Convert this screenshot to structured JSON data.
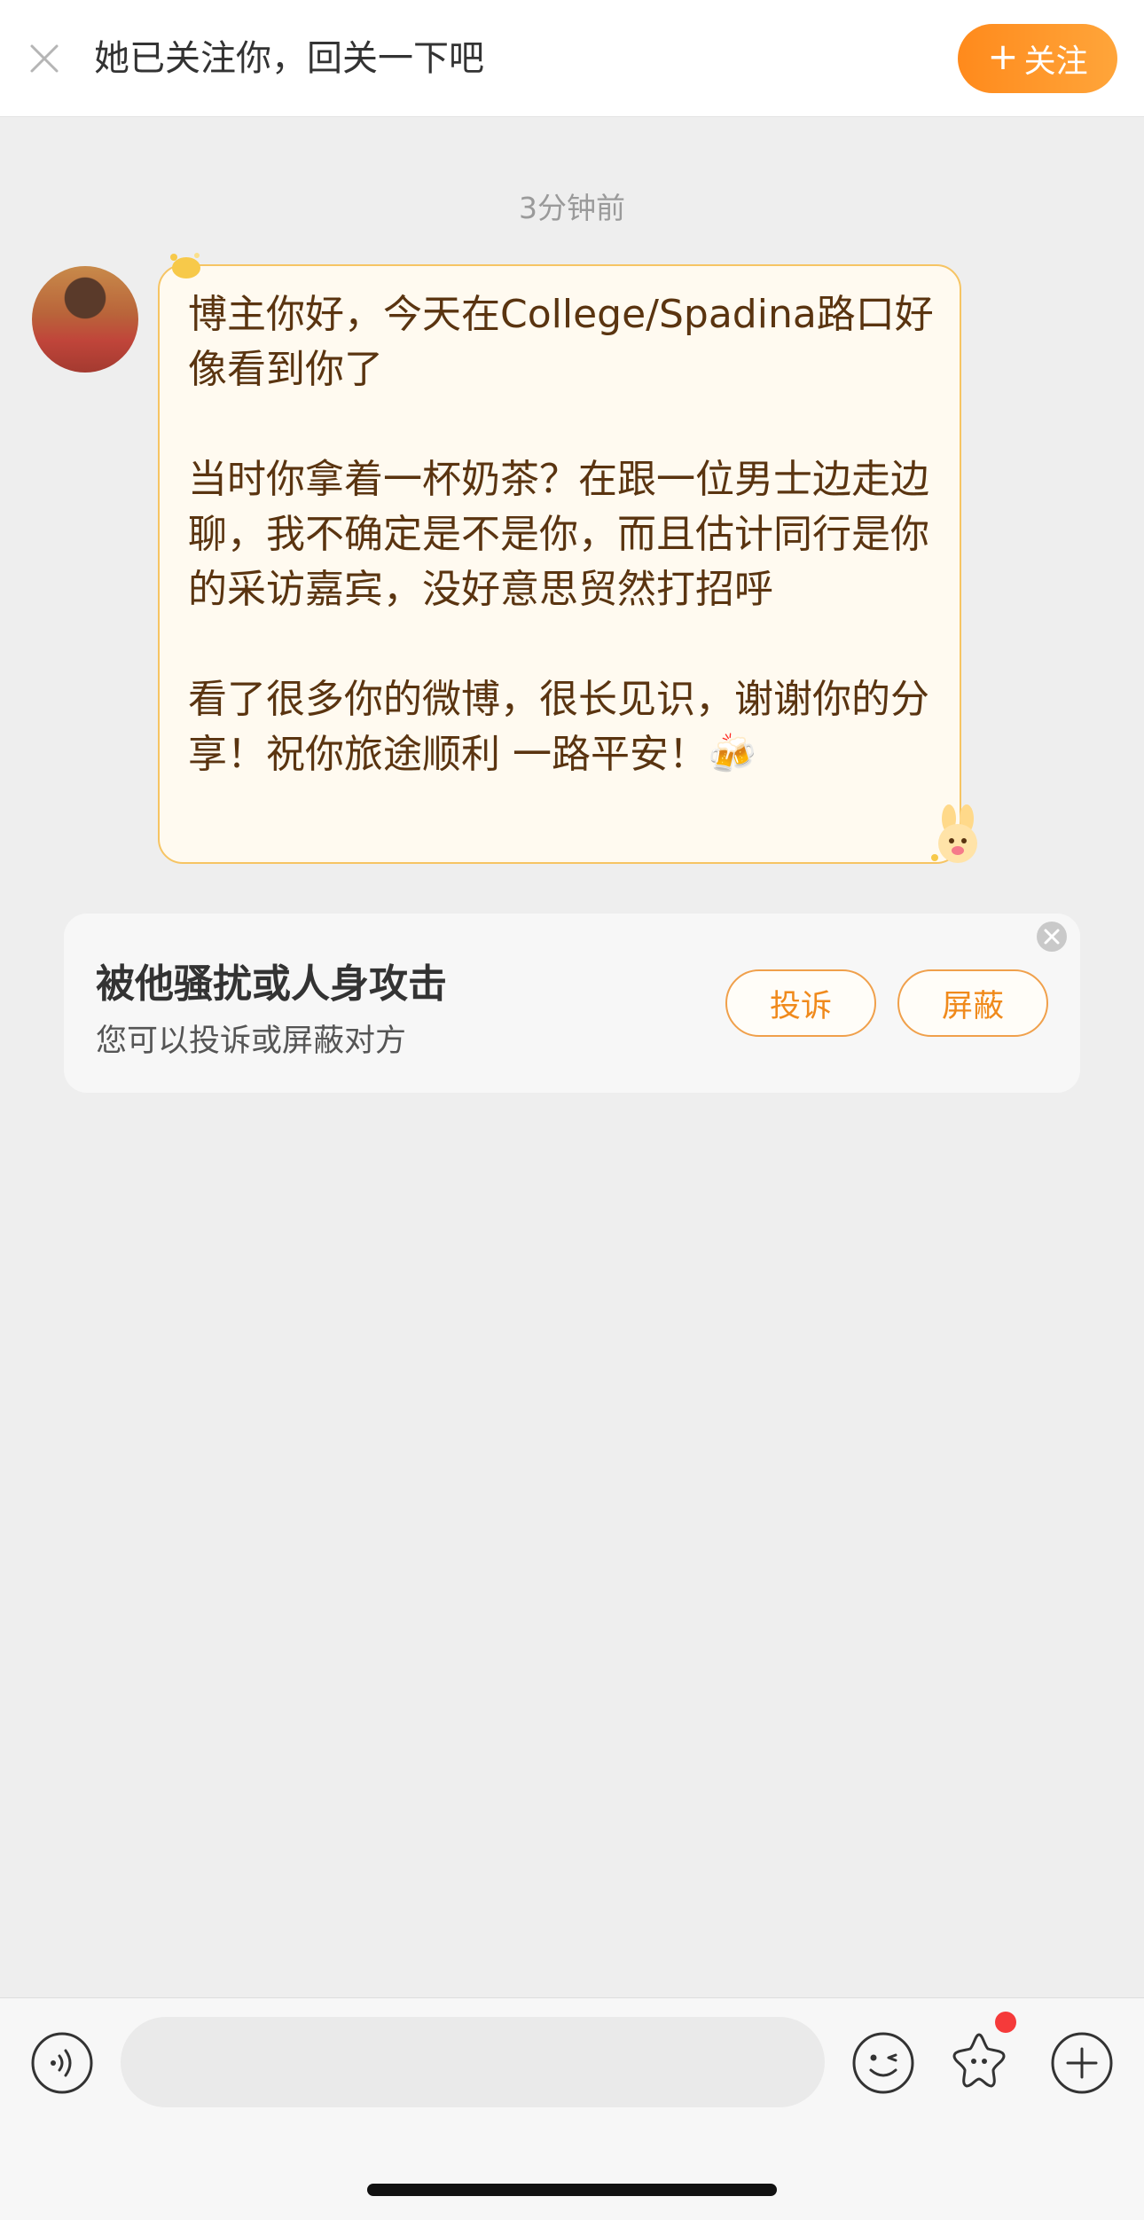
{
  "banner": {
    "text": "她已关注你，回关一下吧",
    "follow_plus": "+",
    "follow_label": "关注"
  },
  "conversation": {
    "timestamp": "3分钟前",
    "message": "博主你好，今天在College/Spadina路口好像看到你了\n\n当时你拿着一杯奶茶？在跟一位男士边走边聊，我不确定是不是你，而且估计同行是你的采访嘉宾，没好意思贸然打招呼\n\n看了很多你的微博，很长见识，谢谢你的分享！祝你旅途顺利 一路平安！🍻"
  },
  "report_card": {
    "title": "被他骚扰或人身攻击",
    "subtitle": "您可以投诉或屏蔽对方",
    "report_label": "投诉",
    "block_label": "屏蔽"
  },
  "input_bar": {
    "placeholder": "",
    "icons": [
      "voice-icon",
      "emoji-icon",
      "star-icon",
      "plus-icon"
    ],
    "has_notification_dot": true
  },
  "colors": {
    "accent": "#ff8a1c",
    "bubble_border": "#f6c463",
    "bubble_text": "#5a3410",
    "notification": "#f53a3a"
  }
}
